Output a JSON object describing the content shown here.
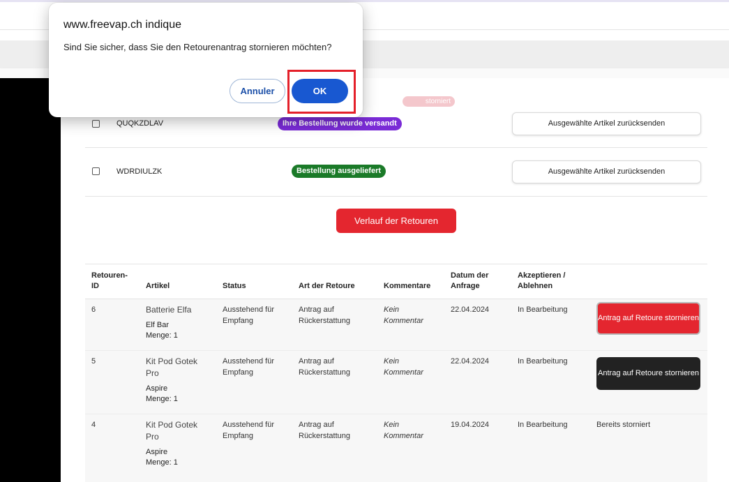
{
  "dialog": {
    "title": "www.freevap.ch indique",
    "message": "Sind Sie sicher, dass Sie den Retourenantrag stornieren möchten?",
    "cancel_label": "Annuler",
    "ok_label": "OK"
  },
  "orders": [
    {
      "id": "QUQKZDLAV",
      "status": "Ihre Bestellung wurde versandt",
      "status_color": "#7a2bd6",
      "action": "Ausgewählte Artikel zurücksenden"
    },
    {
      "id": "WDRDIULZK",
      "status": "Bestellung ausgeliefert",
      "status_color": "#1a7a28",
      "action": "Ausgewählte Artikel zurücksenden"
    }
  ],
  "partial_badge": "storniert",
  "history_button": "Verlauf der Retouren",
  "returns": {
    "headers": {
      "id": "Retouren-ID",
      "article": "Artikel",
      "status": "Status",
      "type": "Art der Retoure",
      "comments": "Kommentare",
      "date": "Datum der Anfrage",
      "accept": "Akzeptieren / Ablehnen"
    },
    "rows": [
      {
        "id": "6",
        "product": "Batterie Elfa",
        "brand": "Elf Bar",
        "qty": "Menge: 1",
        "status": "Ausstehend für Empfang",
        "type": "Antrag auf Rückerstattung",
        "comment": "Kein Kommentar",
        "date": "22.04.2024",
        "decision": "In Bearbeitung",
        "action": "Antrag auf Retoure stornieren"
      },
      {
        "id": "5",
        "product": "Kit Pod Gotek Pro",
        "brand": "Aspire",
        "qty": "Menge: 1",
        "status": "Ausstehend für Empfang",
        "type": "Antrag auf Rückerstattung",
        "comment": "Kein Kommentar",
        "date": "22.04.2024",
        "decision": "In Bearbeitung",
        "action": "Antrag auf Retoure stornieren"
      },
      {
        "id": "4",
        "product": "Kit Pod Gotek Pro",
        "brand": "Aspire",
        "qty": "Menge: 1",
        "status": "Ausstehend für Empfang",
        "type": "Antrag auf Rückerstattung",
        "comment": "Kein Kommentar",
        "date": "19.04.2024",
        "decision": "In Bearbeitung",
        "action": "Bereits storniert"
      }
    ]
  },
  "colors": {
    "accent_red": "#e4262f",
    "dialog_blue": "#1858d1",
    "highlight": "#e4202a"
  }
}
